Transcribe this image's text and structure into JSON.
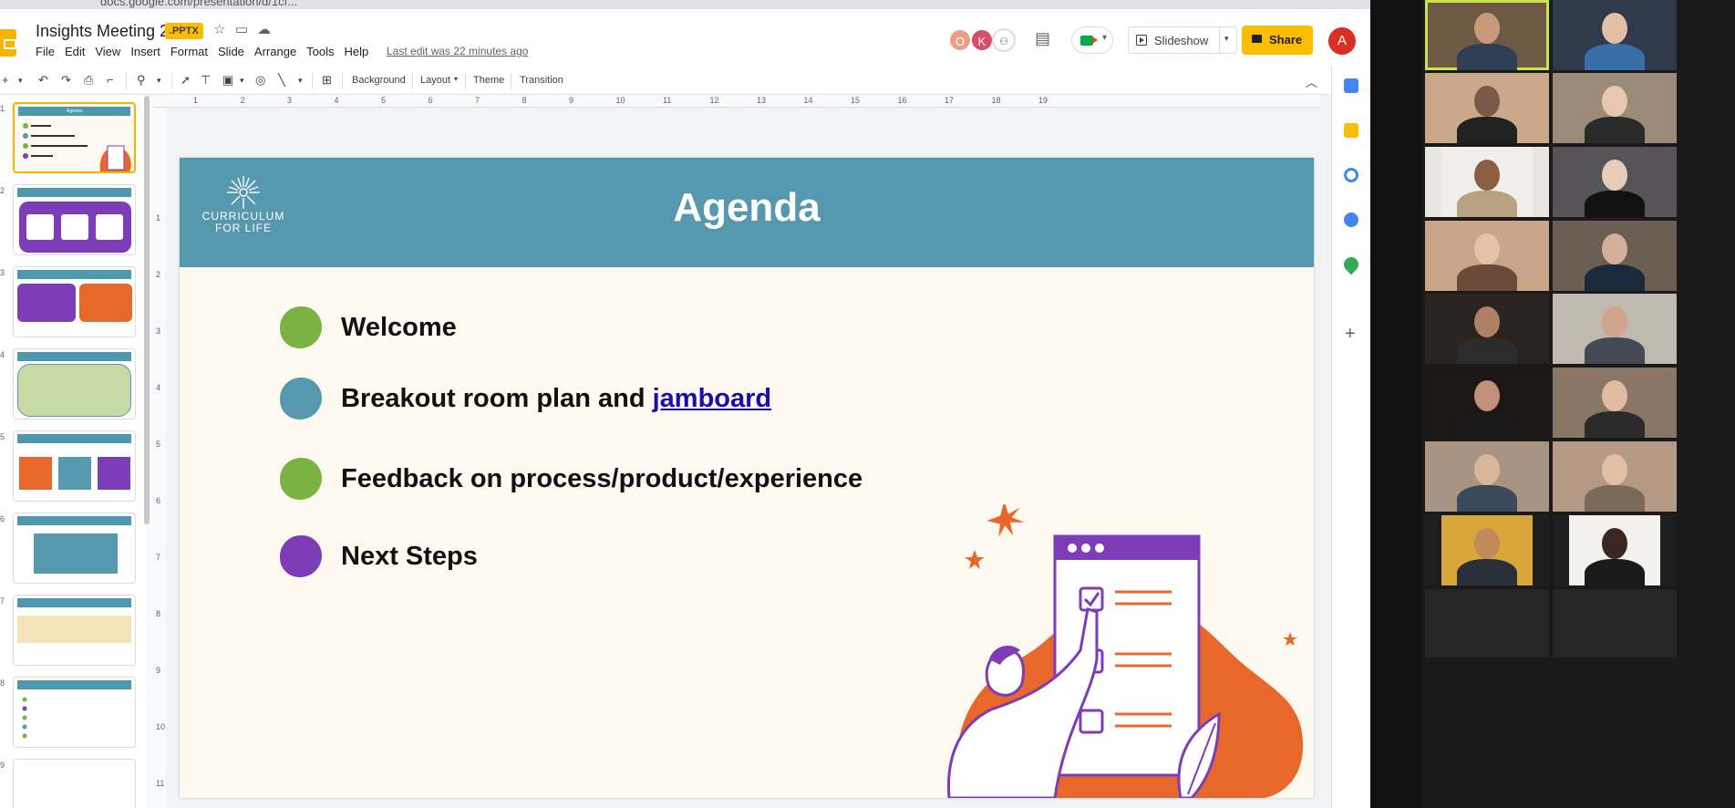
{
  "browser": {
    "url": "docs.google.com/presentation/d/1cf..."
  },
  "doc": {
    "title": "Insights Meeting 2",
    "badge": ".PPTX",
    "menu": [
      "File",
      "Edit",
      "View",
      "Insert",
      "Format",
      "Slide",
      "Arrange",
      "Tools",
      "Help"
    ],
    "last_edit": "Last edit was 22 minutes ago"
  },
  "header": {
    "collaborators": [
      {
        "initial": "O",
        "color": "#e8a087"
      },
      {
        "initial": "K",
        "color": "#d94b6b"
      }
    ],
    "slideshow_label": "Slideshow",
    "share_label": "Share",
    "user_initial": "A",
    "user_color": "#d93025"
  },
  "toolbar": {
    "background_label": "Background",
    "layout_label": "Layout",
    "theme_label": "Theme",
    "transition_label": "Transition"
  },
  "ruler": {
    "top": [
      "1",
      "2",
      "3",
      "4",
      "5",
      "6",
      "7",
      "8",
      "9",
      "10",
      "11",
      "12",
      "13",
      "14",
      "15",
      "16",
      "17",
      "18",
      "19"
    ],
    "left": [
      "1",
      "2",
      "3",
      "4",
      "5",
      "6",
      "7",
      "8",
      "9",
      "10",
      "11"
    ]
  },
  "filmstrip": {
    "slides": [
      {
        "num": "1",
        "title": "Agenda"
      },
      {
        "num": "2",
        "title": ""
      },
      {
        "num": "3",
        "title": ""
      },
      {
        "num": "4",
        "title": ""
      },
      {
        "num": "5",
        "title": ""
      },
      {
        "num": "6",
        "title": ""
      },
      {
        "num": "7",
        "title": ""
      },
      {
        "num": "8",
        "title": ""
      },
      {
        "num": "9",
        "title": ""
      }
    ]
  },
  "slide": {
    "brand_line1": "CURRICULUM",
    "brand_line2": "FOR LIFE",
    "title": "Agenda",
    "items": [
      {
        "text": "Welcome",
        "link": "",
        "color": "#7bb342"
      },
      {
        "text": "Breakout room plan and ",
        "link": "jamboard",
        "color": "#5699ae"
      },
      {
        "text": "Feedback on process/product/experience",
        "link": "",
        "color": "#7bb342"
      },
      {
        "text": "Next Steps",
        "link": "",
        "color": "#7d3cb8"
      }
    ],
    "colors": {
      "header": "#5699ae",
      "orange": "#e8682c",
      "purple": "#7d3cb8",
      "green": "#7bb342"
    }
  },
  "side_panel": {
    "icons": [
      "calendar-icon",
      "keep-icon",
      "tasks-icon",
      "contacts-icon",
      "maps-icon",
      "add-icon"
    ]
  },
  "gallery": {
    "participants": 20,
    "active_speaker_color": "#c8e64c"
  }
}
